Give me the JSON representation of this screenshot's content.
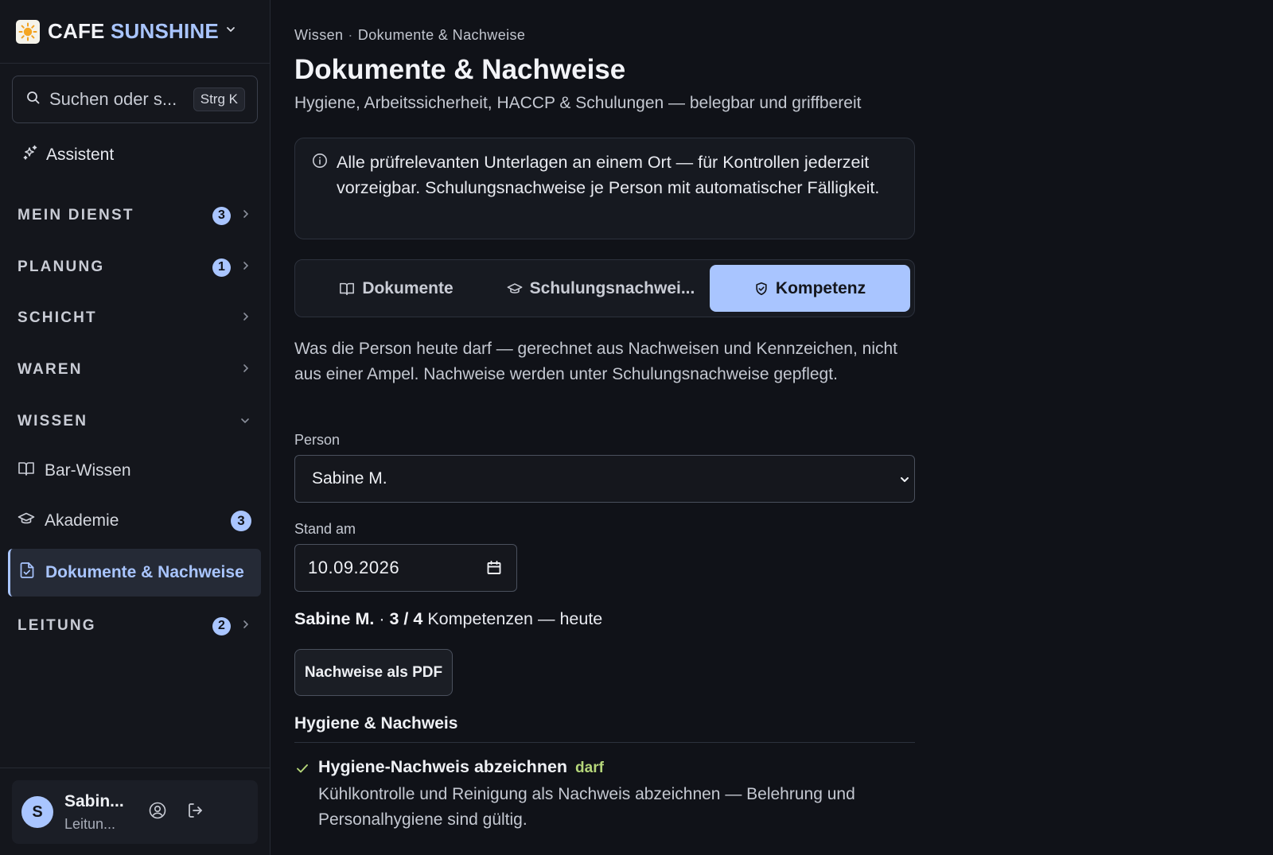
{
  "app": {
    "brand_part1": "CAFE",
    "brand_part2": "SUNSHINE",
    "accent_color": "#a9c5ff"
  },
  "search": {
    "placeholder": "Suchen oder s...",
    "shortcut": "Strg K"
  },
  "sidebar": {
    "assistant_label": "Assistent",
    "sections": [
      {
        "label": "MEIN DIENST",
        "badge": "3"
      },
      {
        "label": "PLANUNG",
        "badge": "1"
      },
      {
        "label": "SCHICHT"
      },
      {
        "label": "WAREN"
      },
      {
        "label": "WISSEN"
      },
      {
        "label": "LEITUNG",
        "badge": "2"
      }
    ],
    "wissen_items": [
      {
        "label": "Bar-Wissen",
        "icon": "book-open-icon"
      },
      {
        "label": "Akademie",
        "icon": "graduation-cap-icon",
        "badge": "3"
      },
      {
        "label": "Dokumente & Nachweise",
        "icon": "file-check-icon",
        "active": true
      }
    ]
  },
  "user": {
    "initial": "S",
    "name": "Sabin...",
    "role": "Leitun..."
  },
  "main": {
    "breadcrumb": [
      "Wissen",
      "Dokumente & Nachweise"
    ],
    "breadcrumb_sep": "·",
    "title": "Dokumente & Nachweise",
    "subtitle": "Hygiene, Arbeitssicherheit, HACCP & Schulungen — belegbar und griffbereit",
    "info": "Alle prüfrelevanten Unterlagen an einem Ort — für Kontrollen jederzeit vorzeigbar. Schulungsnachweise je Person mit automatischer Fälligkeit.",
    "tabs": [
      {
        "label": "Dokumente",
        "icon": "book-open-icon"
      },
      {
        "label": "Schulungsnachwei...",
        "icon": "graduation-cap-icon"
      },
      {
        "label": "Kompetenz",
        "icon": "shield-check-icon",
        "active": true
      }
    ],
    "description": "Was die Person heute darf — gerechnet aus Nachweisen und Kennzeichen, nicht aus einer Ampel. Nachweise werden unter Schulungsnachweise gepflegt.",
    "person_label": "Person",
    "person_value": "Sabine M.",
    "date_label": "Stand am",
    "date_value": "10.09.2026",
    "summary_name": "Sabine M.",
    "summary_sep": "·",
    "summary_count": "3 / 4",
    "summary_rest": "Kompetenzen — heute",
    "pdf_button": "Nachweise als PDF",
    "section_title": "Hygiene & Nachweis",
    "competencies": [
      {
        "title": "Hygiene-Nachweis abzeichnen",
        "status": "darf",
        "status_color": "#b5d67a",
        "text": "Kühlkontrolle und Reinigung als Nachweis abzeichnen — Belehrung und Personalhygiene sind gültig."
      }
    ]
  }
}
